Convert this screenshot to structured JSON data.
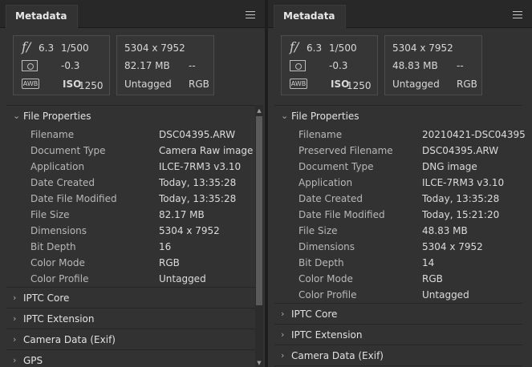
{
  "panels": {
    "left": {
      "tab_label": "Metadata",
      "summary": {
        "aperture": "6.3",
        "shutter": "1/500",
        "exposure_comp": "-0.3",
        "iso_label": "ISO",
        "iso_value": "1250",
        "awb_label": "AWB",
        "dimensions": "5304 x 7952",
        "file_size": "82.17 MB",
        "extra": "--",
        "tag_status": "Untagged",
        "color_mode": "RGB"
      },
      "file_properties": {
        "title": "File Properties",
        "rows": [
          {
            "label": "Filename",
            "value": "DSC04395.ARW"
          },
          {
            "label": "Document Type",
            "value": "Camera Raw image"
          },
          {
            "label": "Application",
            "value": "ILCE-7RM3 v3.10"
          },
          {
            "label": "Date Created",
            "value": "Today, 13:35:28"
          },
          {
            "label": "Date File Modified",
            "value": "Today, 13:35:28"
          },
          {
            "label": "File Size",
            "value": "82.17 MB"
          },
          {
            "label": "Dimensions",
            "value": "5304 x 7952"
          },
          {
            "label": "Bit Depth",
            "value": "16"
          },
          {
            "label": "Color Mode",
            "value": "RGB"
          },
          {
            "label": "Color Profile",
            "value": "Untagged"
          }
        ]
      },
      "sections": [
        "IPTC Core",
        "IPTC Extension",
        "Camera Data (Exif)",
        "GPS"
      ]
    },
    "right": {
      "tab_label": "Metadata",
      "summary": {
        "aperture": "6.3",
        "shutter": "1/500",
        "exposure_comp": "-0.3",
        "iso_label": "ISO",
        "iso_value": "1250",
        "awb_label": "AWB",
        "dimensions": "5304 x 7952",
        "file_size": "48.83 MB",
        "extra": "--",
        "tag_status": "Untagged",
        "color_mode": "RGB"
      },
      "file_properties": {
        "title": "File Properties",
        "rows": [
          {
            "label": "Filename",
            "value": "20210421-DSC04395"
          },
          {
            "label": "Preserved Filename",
            "value": "DSC04395.ARW"
          },
          {
            "label": "Document Type",
            "value": "DNG image"
          },
          {
            "label": "Application",
            "value": "ILCE-7RM3 v3.10"
          },
          {
            "label": "Date Created",
            "value": "Today, 13:35:28"
          },
          {
            "label": "Date File Modified",
            "value": "Today, 15:21:20"
          },
          {
            "label": "File Size",
            "value": "48.83 MB"
          },
          {
            "label": "Dimensions",
            "value": "5304 x 7952"
          },
          {
            "label": "Bit Depth",
            "value": "14"
          },
          {
            "label": "Color Mode",
            "value": "RGB"
          },
          {
            "label": "Color Profile",
            "value": "Untagged"
          }
        ]
      },
      "sections": [
        "IPTC Core",
        "IPTC Extension",
        "Camera Data (Exif)"
      ]
    }
  },
  "icons": {
    "f_stop_glyph": "f/",
    "expanded_chevron": "⌵",
    "collapsed_chevron": "›"
  }
}
